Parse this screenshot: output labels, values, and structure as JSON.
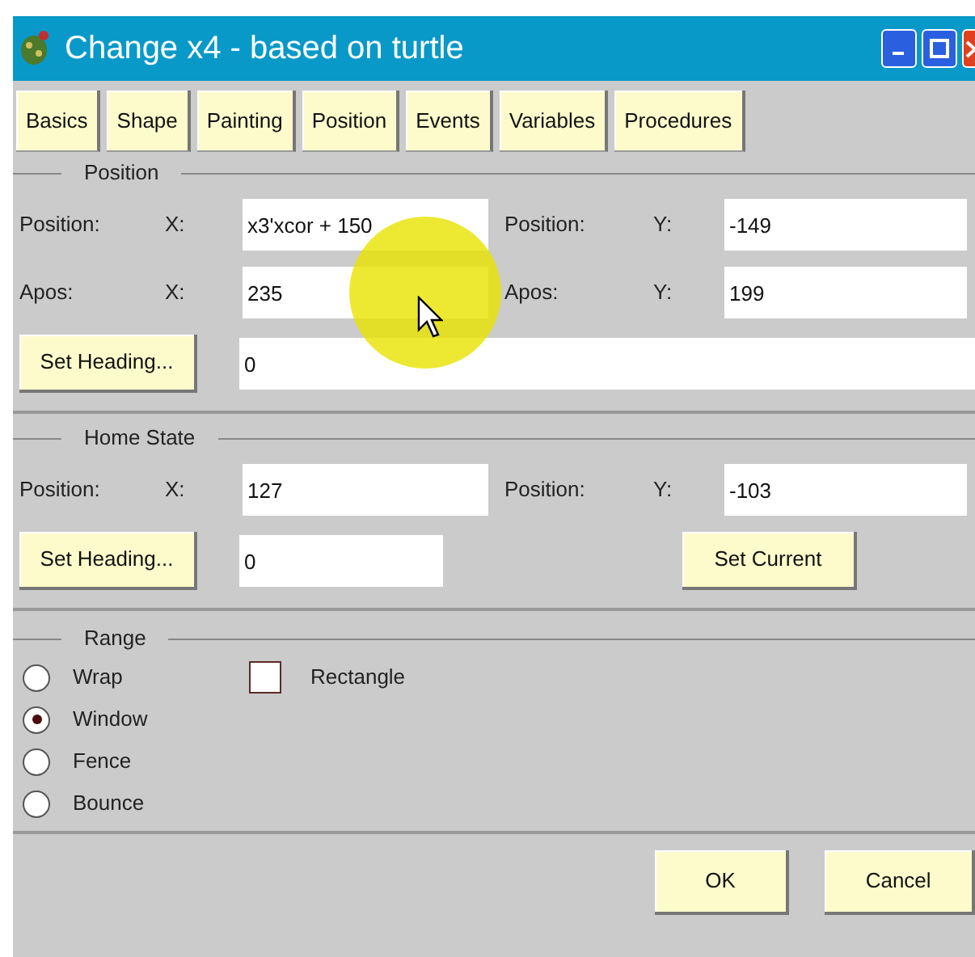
{
  "window": {
    "title": "Change x4 - based on turtle"
  },
  "tabs": [
    {
      "label": "Basics"
    },
    {
      "label": "Shape"
    },
    {
      "label": "Painting"
    },
    {
      "label": "Position"
    },
    {
      "label": "Events"
    },
    {
      "label": "Variables"
    },
    {
      "label": "Procedures"
    }
  ],
  "position": {
    "title": "Position",
    "rows": [
      {
        "fields": [
          {
            "label": "Position:",
            "axis": "X:",
            "value": "x3'xcor + 150"
          },
          {
            "label": "Position:",
            "axis": "Y:",
            "value": "-149"
          }
        ]
      },
      {
        "fields": [
          {
            "label": "Apos:",
            "axis": "X:",
            "value": "235"
          },
          {
            "label": "Apos:",
            "axis": "Y:",
            "value": "199"
          }
        ]
      }
    ],
    "heading_button": "Set Heading...",
    "heading_value": "0"
  },
  "home_state": {
    "title": "Home State",
    "fields": [
      {
        "label": "Position:",
        "axis": "X:",
        "value": "127"
      },
      {
        "label": "Position:",
        "axis": "Y:",
        "value": "-103"
      }
    ],
    "heading_button": "Set Heading...",
    "heading_value": "0",
    "set_current_button": "Set Current"
  },
  "range": {
    "title": "Range",
    "options": [
      {
        "label": "Wrap",
        "selected": false
      },
      {
        "label": "Window",
        "selected": true
      },
      {
        "label": "Fence",
        "selected": false
      },
      {
        "label": "Bounce",
        "selected": false
      }
    ],
    "rectangle": {
      "label": "Rectangle",
      "checked": false
    }
  },
  "buttons": [
    "OK",
    "Cancel"
  ]
}
